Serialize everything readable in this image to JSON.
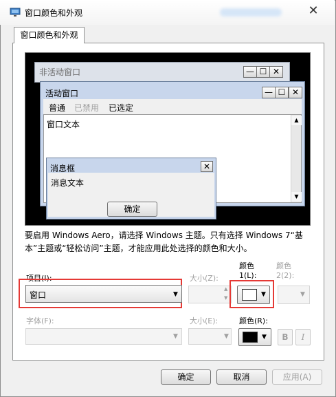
{
  "window": {
    "title": "窗口颜色和外观"
  },
  "tab": {
    "label": "窗口颜色和外观"
  },
  "preview": {
    "inactive_title": "非活动窗口",
    "active_title": "活动窗口",
    "menu": [
      "普通",
      "已禁用",
      "已选定"
    ],
    "window_text": "窗口文本",
    "msgbox_title": "消息框",
    "msgbox_text": "消息文本",
    "ok_label": "确定",
    "caption_buttons": [
      "—",
      "☐",
      "✕"
    ]
  },
  "description": "要启用 Windows Aero，请选择 Windows 主题。只有选择 Windows 7“基本”主题或“轻松访问”主题，才能应用此处选择的颜色和大小。",
  "item": {
    "label": "项目(I):",
    "value": "窗口"
  },
  "size1": {
    "label": "大小(Z):"
  },
  "color1": {
    "label_line1": "颜色",
    "label_line2": "1(L):",
    "swatch": "#ffffff"
  },
  "color2": {
    "label_line1": "颜色",
    "label_line2": "2(2):"
  },
  "font": {
    "label": "字体(F):"
  },
  "size2": {
    "label": "大小(E):"
  },
  "font_color": {
    "label": "颜色(R):",
    "swatch": "#000000"
  },
  "bold_label": "B",
  "italic_label": "I",
  "buttons": {
    "ok": "确定",
    "cancel": "取消",
    "apply": "应用(A)"
  },
  "icons": {
    "close": "✕",
    "dropdown": "▼",
    "scroll_up": "▲",
    "scroll_down": "▼",
    "spin_up": "▲",
    "spin_down": "▼"
  }
}
